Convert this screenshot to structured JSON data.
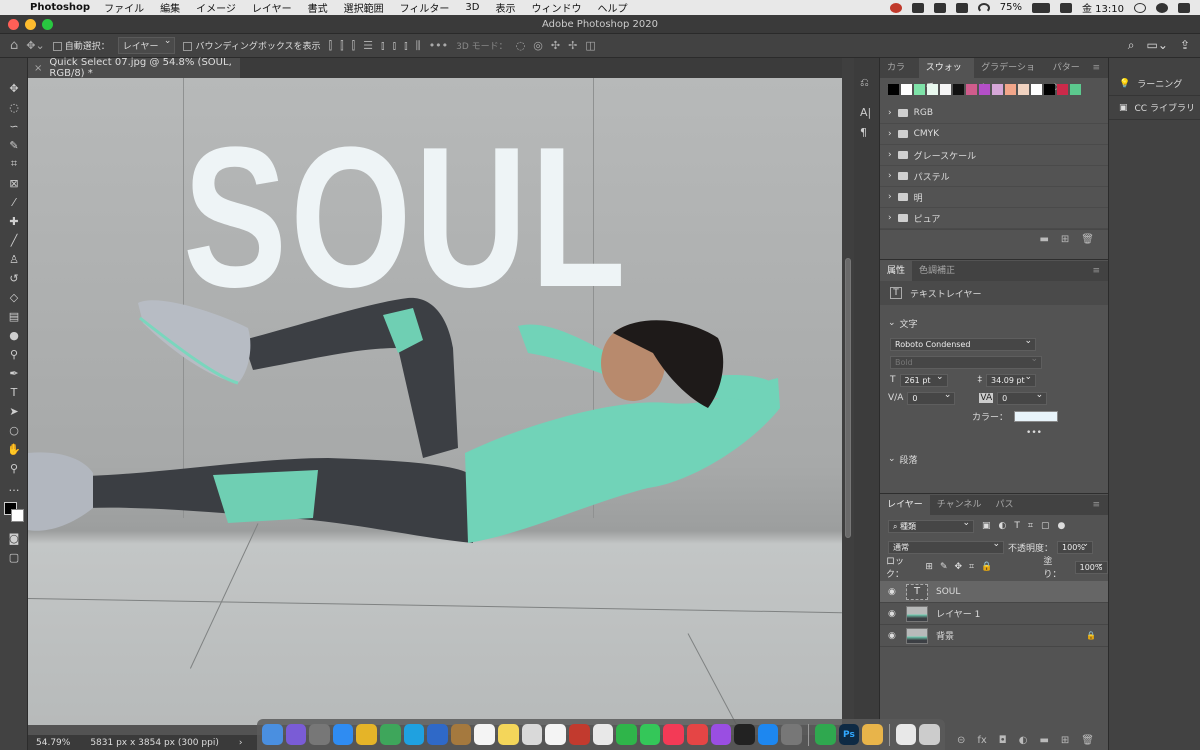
{
  "menubar": {
    "app": "Photoshop",
    "items": [
      "ファイル",
      "編集",
      "イメージ",
      "レイヤー",
      "書式",
      "選択範囲",
      "フィルター",
      "3D",
      "表示",
      "ウィンドウ",
      "ヘルプ"
    ],
    "battery": "75%",
    "clock": "金 13:10"
  },
  "window": {
    "title": "Adobe Photoshop 2020"
  },
  "options": {
    "auto_select_label": "自動選択：",
    "auto_select_value": "レイヤー",
    "bounding_box_label": "バウンディングボックスを表示",
    "three_d_mode": "3D モード："
  },
  "document": {
    "tab_title": "Quick Select 07.jpg @ 54.8% (SOUL, RGB/8) *",
    "canvas_text": "SOUL",
    "zoom": "54.79%",
    "size_info": "5831 px x 3854 px (300 ppi)"
  },
  "swatches_panel": {
    "tabs": [
      "カラー",
      "スウォッチ",
      "グラデーション",
      "パターン"
    ],
    "active_tab": "スウォッチ",
    "colors": [
      "#000000",
      "#ffffff",
      "#7ee2a8",
      "#e8f8ee",
      "#f4f4f4",
      "#111111",
      "#d05c8c",
      "#b44fc8",
      "#d6a7d8",
      "#f2a68a",
      "#f0d2c0",
      "#ffffff",
      "#000000",
      "#cc2a4a",
      "#5cc98e"
    ],
    "folders": [
      "RGB",
      "CMYK",
      "グレースケール",
      "パステル",
      "明",
      "ピュア"
    ]
  },
  "properties_panel": {
    "tabs": [
      "属性",
      "色調補正"
    ],
    "active_tab": "属性",
    "layer_type": "テキストレイヤー",
    "section_text": "文字",
    "font_family": "Roboto Condensed",
    "font_style": "Bold",
    "font_size": "261 pt",
    "leading": "34.09 pt",
    "kerning": "0",
    "tracking": "0",
    "color_label": "カラー：",
    "color_value": "#e8f4fa",
    "more": "•••",
    "section_paragraph": "段落"
  },
  "layers_panel": {
    "tabs": [
      "レイヤー",
      "チャンネル",
      "パス"
    ],
    "active_tab": "レイヤー",
    "filter_kind": "種類",
    "blend_mode": "通常",
    "opacity_label": "不透明度：",
    "opacity": "100%",
    "lock_label": "ロック：",
    "fill_label": "塗り：",
    "fill": "100%",
    "layers": [
      {
        "name": "SOUL",
        "type": "text",
        "selected": true
      },
      {
        "name": "レイヤー 1",
        "type": "image",
        "selected": false
      },
      {
        "name": "背景",
        "type": "image",
        "selected": false,
        "locked": true
      }
    ]
  },
  "right_panel": {
    "items": [
      "ラーニング",
      "CC ライブラリ"
    ]
  },
  "dock": {
    "apps": [
      {
        "name": "finder",
        "color": "#4a8fe0"
      },
      {
        "name": "siri",
        "color": "#7a5cd6"
      },
      {
        "name": "launchpad",
        "color": "#777"
      },
      {
        "name": "safari",
        "color": "#2f8cf2"
      },
      {
        "name": "chrome",
        "color": "#e5b428"
      },
      {
        "name": "chrome-canary",
        "color": "#3ea65b"
      },
      {
        "name": "skype",
        "color": "#1fa1e0"
      },
      {
        "name": "preview",
        "color": "#2f69c8"
      },
      {
        "name": "notebook",
        "color": "#a5793e"
      },
      {
        "name": "calendar",
        "color": "#f4f4f4"
      },
      {
        "name": "notes",
        "color": "#f4d65a"
      },
      {
        "name": "photos-app",
        "color": "#d9d9d9"
      },
      {
        "name": "reminders",
        "color": "#f4f4f4"
      },
      {
        "name": "dictionary",
        "color": "#c23a2e"
      },
      {
        "name": "photos",
        "color": "#e8e8e8"
      },
      {
        "name": "facetime",
        "color": "#2fb54a"
      },
      {
        "name": "messages",
        "color": "#34c759"
      },
      {
        "name": "music",
        "color": "#f33a56"
      },
      {
        "name": "news",
        "color": "#e54545"
      },
      {
        "name": "podcasts",
        "color": "#9a4ee2"
      },
      {
        "name": "tv",
        "color": "#222"
      },
      {
        "name": "app-store",
        "color": "#1d87f0"
      },
      {
        "name": "system-preferences",
        "color": "#777"
      },
      {
        "name": "numbers",
        "color": "#2fa84f"
      },
      {
        "name": "photoshop",
        "color": "#0e2a44",
        "label": "Ps"
      },
      {
        "name": "illustrator",
        "color": "#e8b44a"
      },
      {
        "name": "documents",
        "color": "#e8e8e8"
      },
      {
        "name": "trash",
        "color": "#ccc"
      }
    ]
  }
}
